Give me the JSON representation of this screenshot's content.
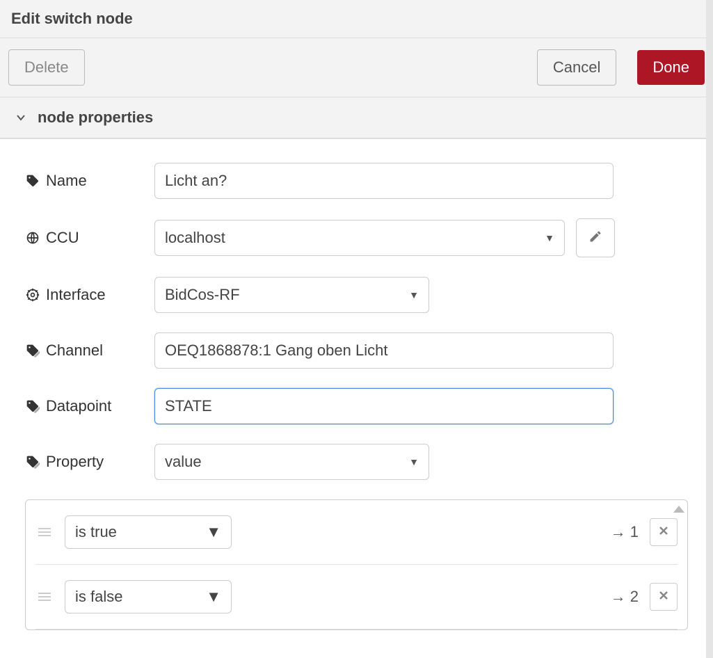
{
  "header": {
    "title": "Edit switch node"
  },
  "actions": {
    "delete": "Delete",
    "cancel": "Cancel",
    "done": "Done"
  },
  "section": {
    "properties": "node properties"
  },
  "form": {
    "name": {
      "label": "Name",
      "value": "Licht an?"
    },
    "ccu": {
      "label": "CCU",
      "value": "localhost"
    },
    "interface": {
      "label": "Interface",
      "value": "BidCos-RF"
    },
    "channel": {
      "label": "Channel",
      "value": "OEQ1868878:1 Gang oben Licht"
    },
    "datapoint": {
      "label": "Datapoint",
      "value": "STATE"
    },
    "property": {
      "label": "Property",
      "value": "value"
    }
  },
  "rules": [
    {
      "op": "is true",
      "arrow": "→",
      "output": "1"
    },
    {
      "op": "is false",
      "arrow": "→",
      "output": "2"
    }
  ]
}
